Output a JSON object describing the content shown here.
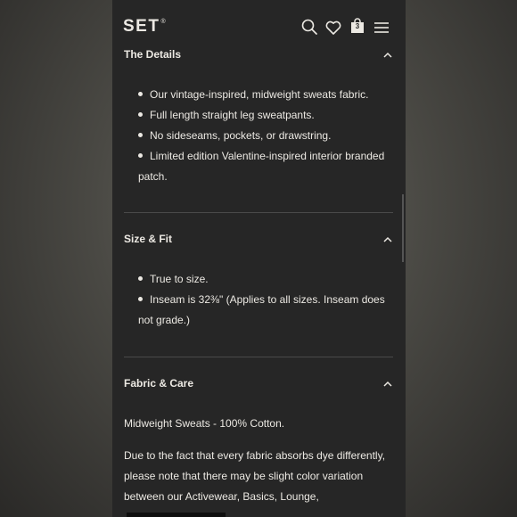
{
  "header": {
    "logo": "SET",
    "logo_mark": "®",
    "bag_count": "3",
    "icons": [
      "search-icon",
      "heart-icon",
      "bag-icon",
      "menu-icon"
    ]
  },
  "sections": [
    {
      "title": "The Details",
      "items": [
        "Our vintage-inspired, midweight sweats fabric.",
        "Full length straight leg sweatpants.",
        "No sideseams, pockets, or drawstring.",
        "Limited edition Valentine-inspired interior branded patch."
      ]
    },
    {
      "title": "Size & Fit",
      "items": [
        "True to size.",
        "Inseam is 32⅜\" (Applies to all sizes. Inseam does not grade.)"
      ]
    },
    {
      "title": "Fabric & Care",
      "paragraphs": [
        "Midweight Sweats - 100% Cotton.",
        "Due to the fact that every fabric absorbs dye differently, please note that there may be slight color variation between our Activewear, Basics, Lounge,"
      ]
    }
  ],
  "colors": {
    "background": "#262626",
    "text": "#ece9e3",
    "divider": "#4a4a4a"
  }
}
